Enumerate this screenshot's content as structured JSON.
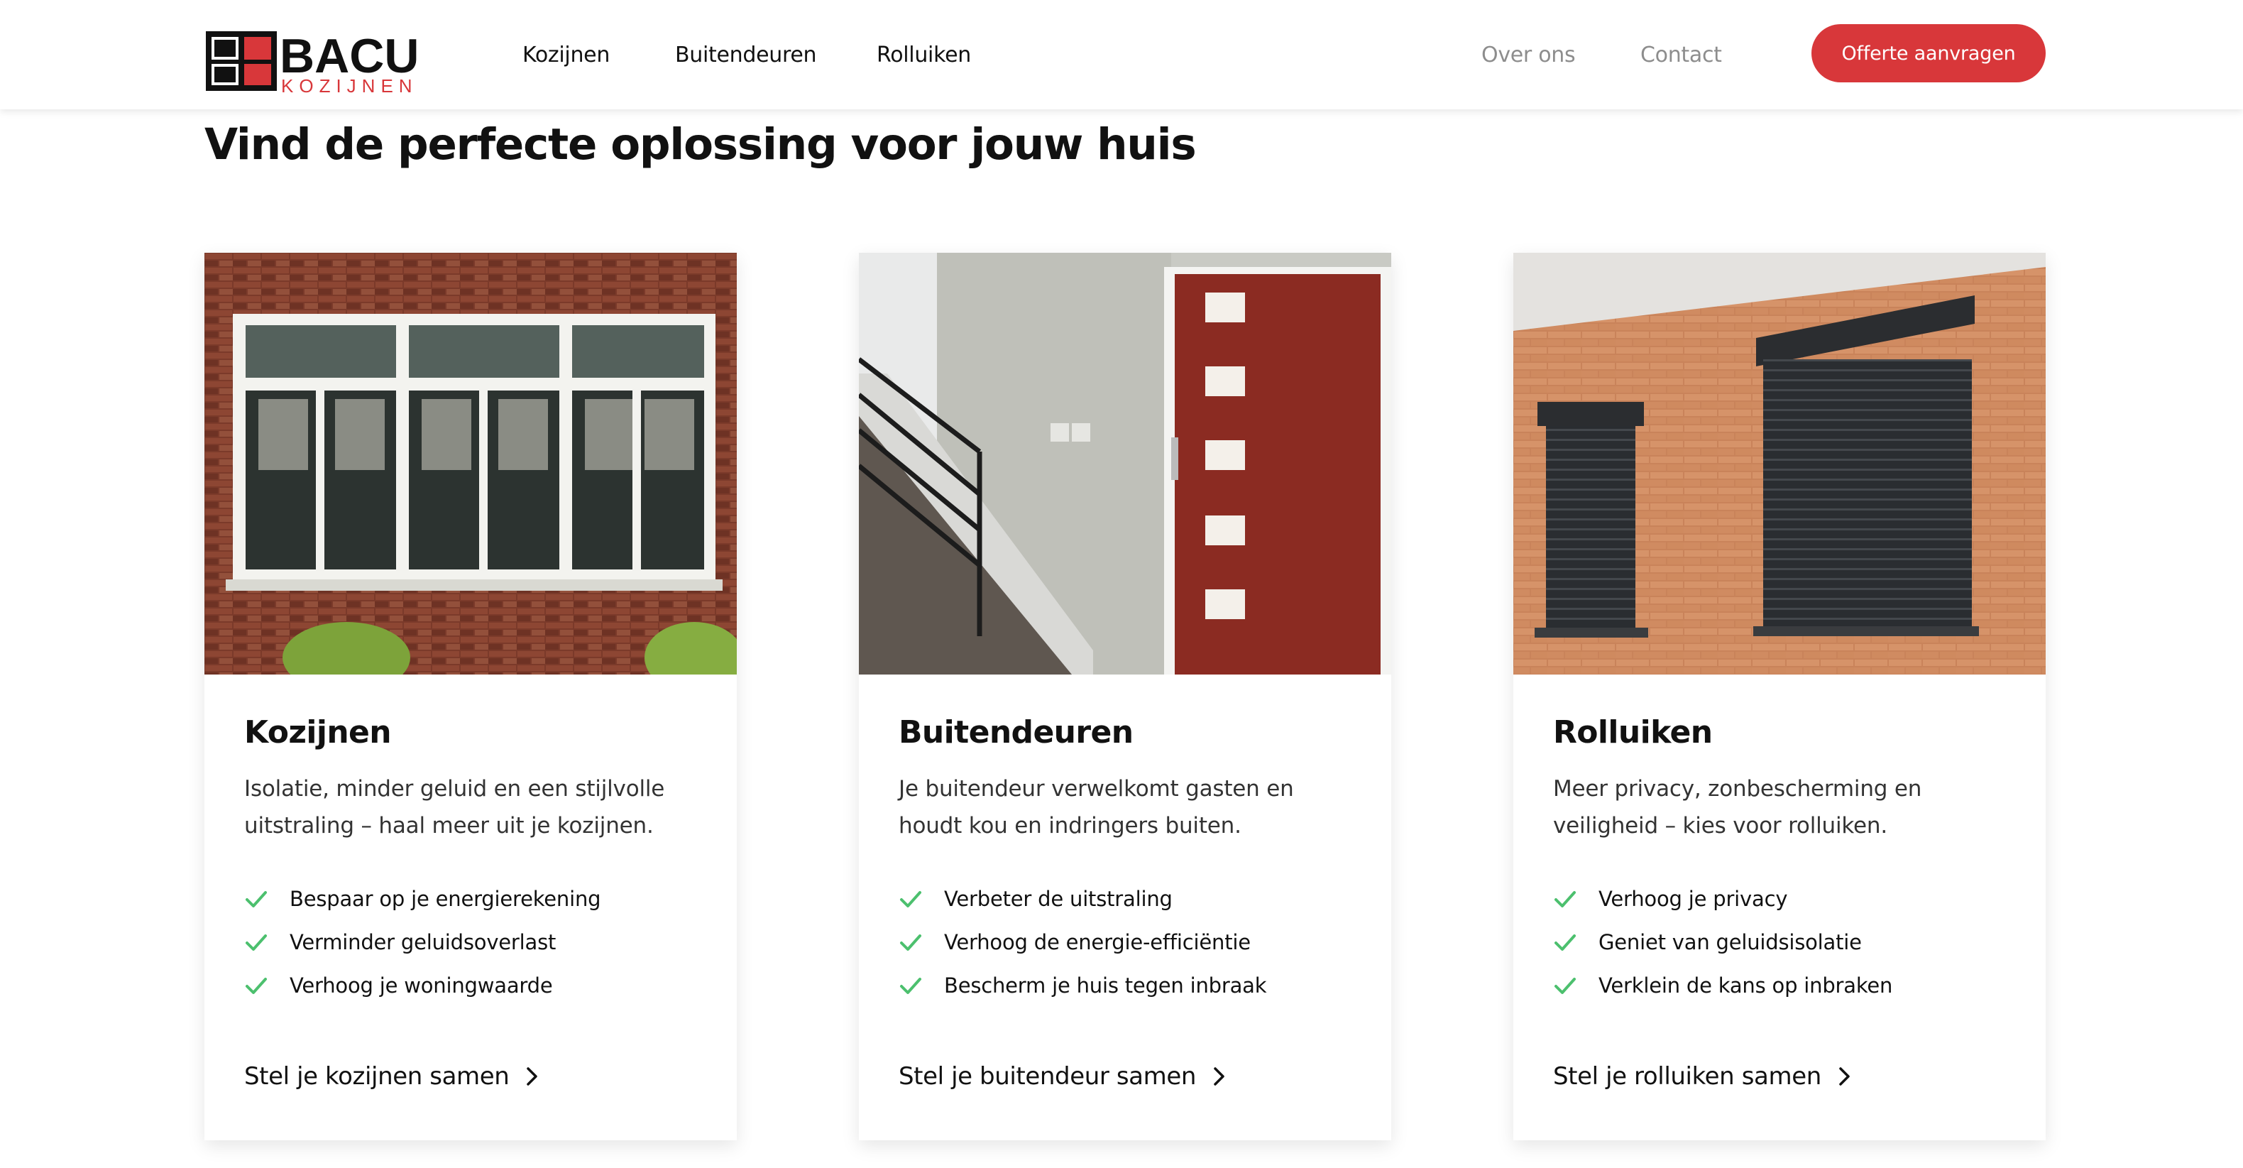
{
  "brand": {
    "logo_main": "BACU",
    "logo_sub": "KOZIJNEN",
    "accent": "#d8373a",
    "check_color": "#4cc06e"
  },
  "nav": {
    "primary": [
      "Kozijnen",
      "Buitendeuren",
      "Rolluiken"
    ],
    "secondary": [
      "Over ons",
      "Contact"
    ],
    "cta_label": "Offerte aanvragen"
  },
  "page": {
    "title": "Vind de perfecte oplossing voor jouw huis"
  },
  "cards": [
    {
      "title": "Kozijnen",
      "description": "Isolatie, minder geluid en een stijlvolle uitstraling – haal meer uit je kozijnen.",
      "features": [
        "Bespaar op je energierekening",
        "Verminder geluidsoverlast",
        "Verhoog je woningwaarde"
      ],
      "link_label": "Stel je kozijnen samen",
      "image_icon": "window-frame-photo"
    },
    {
      "title": "Buitendeuren",
      "description": "Je buitendeur verwelkomt gasten en houdt kou en indringers buiten.",
      "features": [
        "Verbeter de uitstraling",
        "Verhoog de energie-efficiëntie",
        "Bescherm je huis tegen inbraak"
      ],
      "link_label": "Stel je buitendeur samen",
      "image_icon": "front-door-photo"
    },
    {
      "title": "Rolluiken",
      "description": "Meer privacy, zonbescherming en veiligheid – kies voor rolluiken.",
      "features": [
        "Verhoog je privacy",
        "Geniet van geluidsisolatie",
        "Verklein de kans op inbraken"
      ],
      "link_label": "Stel je rolluiken samen",
      "image_icon": "roller-shutter-photo"
    }
  ]
}
